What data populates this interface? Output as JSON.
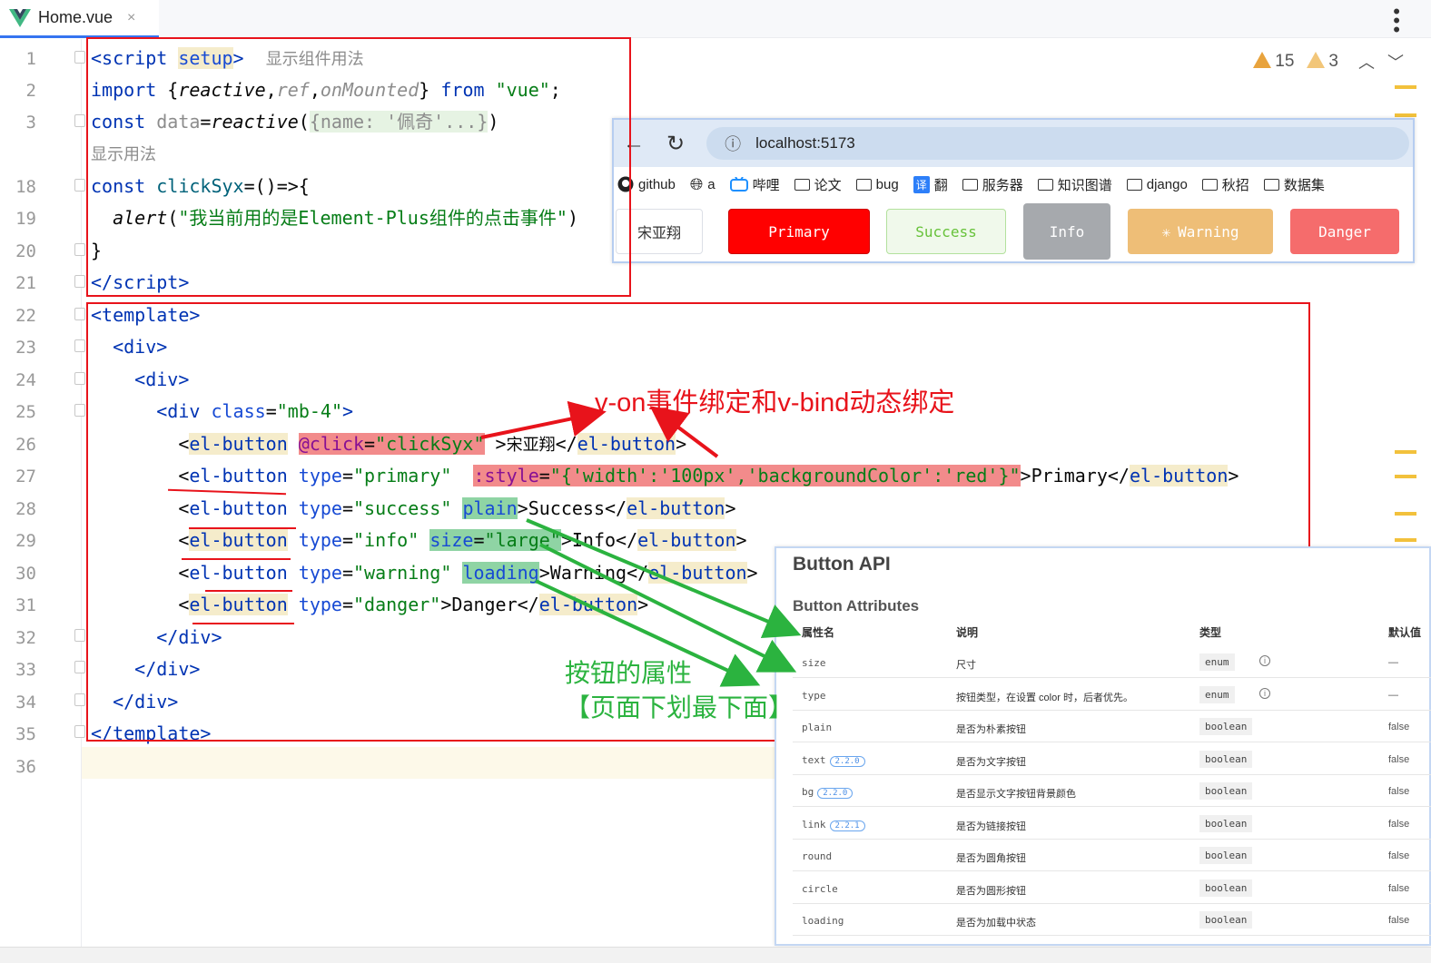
{
  "tab": {
    "filename": "Home.vue",
    "close": "×",
    "menu": "⋮"
  },
  "inspections": {
    "errors": "15",
    "warnings": "3",
    "up": "^",
    "down": "v"
  },
  "line_numbers": [
    "1",
    "2",
    "3",
    "18",
    "19",
    "20",
    "21",
    "22",
    "23",
    "24",
    "25",
    "26",
    "27",
    "28",
    "29",
    "30",
    "31",
    "32",
    "33",
    "34",
    "35",
    "36"
  ],
  "code": {
    "l1": {
      "open": "<script ",
      "setup": "setup",
      "close": ">",
      "hint": "显示组件用法"
    },
    "l2": {
      "kw": "import ",
      "brace_open": "{",
      "reactive": "reactive",
      "c1": ",",
      "ref": "ref",
      "c2": ",",
      "onMounted": "onMounted",
      "brace_close": "} ",
      "from": "from ",
      "str": "\"vue\"",
      "semi": ";"
    },
    "l3": {
      "kw": "const ",
      "var": "data",
      "eq": "=",
      "fn": "reactive",
      "p1": "(",
      "fold": "{name: '佩奇'...}",
      "p2": ")"
    },
    "l3b": "显示用法",
    "l18": {
      "kw": "const ",
      "fn": "clickSyx",
      "rest": "=()=>{"
    },
    "l19": {
      "fn": "alert",
      "p1": "(",
      "str": "\"我当前用的是Element-Plus组件的点击事件\"",
      "p2": ")"
    },
    "l20": "}",
    "l21": {
      "open": "</",
      "tag": "script",
      "close": ">"
    },
    "l22": "<template>",
    "l23": "<div>",
    "l24": "<div>",
    "l25": {
      "open": "<div ",
      "attr": "class",
      "eq": "=",
      "str": "\"mb-4\"",
      "close": ">"
    },
    "l26": {
      "lt": "<",
      "tag": "el-button",
      "sp": " ",
      "ev": "@click",
      "eq": "=",
      "str": "\"clickSyx\"",
      "gt": " >",
      "text": "宋亚翔",
      "end_lt": "</",
      "end_tag": "el-button",
      "end_gt": ">"
    },
    "l27": {
      "lt": "<",
      "tag": "el-button",
      "attr": " type",
      "eq": "=",
      "str": "\"primary\"",
      "sp": "  ",
      "bind": ":style",
      "eq2": "=",
      "str2": "\"{'width':'100px','backgroundColor':'red'}\"",
      "gt": ">",
      "text": "Primary",
      "end_lt": "</",
      "end_tag": "el-button",
      "end_gt": ">"
    },
    "l28": {
      "lt": "<",
      "tag": "el-button",
      "attr": " type",
      "eq": "=",
      "str": "\"success\"",
      "sp": " ",
      "flag": "plain",
      "gt": ">",
      "text": "Success",
      "end_lt": "</",
      "end_tag": "el-button",
      "end_gt": ">"
    },
    "l29": {
      "lt": "<",
      "tag": "el-button",
      "attr": " type",
      "eq": "=",
      "str": "\"info\"",
      "sp": " ",
      "attr2": "size",
      "eq2": "=",
      "str2": "\"large\"",
      "gt": ">",
      "text": "Info",
      "end_lt": "</",
      "end_tag": "el-button",
      "end_gt": ">"
    },
    "l30": {
      "lt": "<",
      "tag": "el-button",
      "attr": " type",
      "eq": "=",
      "str": "\"warning\"",
      "sp": " ",
      "flag": "loading",
      "gt": ">",
      "text": "Warning",
      "end_lt": "</",
      "end_tag": "el-button",
      "end_gt": ">"
    },
    "l31": {
      "lt": "<",
      "tag": "el-button",
      "attr": " type",
      "eq": "=",
      "str": "\"danger\"",
      "gt": ">",
      "text": "Danger",
      "end_lt": "</",
      "end_tag": "el-button",
      "end_gt": ">"
    },
    "l32": "</div>",
    "l33": "</div>",
    "l34": "</div>",
    "l35": "</template>"
  },
  "browser": {
    "back": "←",
    "reload": "↻",
    "info": "ⓘ",
    "url": "localhost:5173",
    "bookmarks": [
      "github",
      "a",
      "哔哩",
      "论文",
      "bug",
      "翻",
      "服务器",
      "知识图谱",
      "django",
      "秋招",
      "数据集"
    ],
    "translate_badge": "译",
    "buttons": {
      "b1": "宋亚翔",
      "primary": "Primary",
      "success": "Success",
      "info": "Info",
      "warning": "Warning",
      "danger": "Danger"
    }
  },
  "annotations": {
    "red": "v-on事件绑定和v-bind动态绑定",
    "green1": "按钮的属性",
    "green2": "【页面下划最下面】"
  },
  "api": {
    "title": "Button API",
    "subtitle": "Button Attributes",
    "headers": [
      "属性名",
      "说明",
      "类型",
      "默认值"
    ],
    "rows": [
      {
        "name": "size",
        "version": "",
        "desc": "尺寸",
        "type": "enum",
        "info": "i",
        "default": "—"
      },
      {
        "name": "type",
        "version": "",
        "desc": "按钮类型，在设置 color 时，后者优先。",
        "type": "enum",
        "info": "i",
        "default": "—"
      },
      {
        "name": "plain",
        "version": "",
        "desc": "是否为朴素按钮",
        "type": "boolean",
        "info": "",
        "default": "false"
      },
      {
        "name": "text",
        "version": "2.2.0",
        "desc": "是否为文字按钮",
        "type": "boolean",
        "info": "",
        "default": "false"
      },
      {
        "name": "bg",
        "version": "2.2.0",
        "desc": "是否显示文字按钮背景颜色",
        "type": "boolean",
        "info": "",
        "default": "false"
      },
      {
        "name": "link",
        "version": "2.2.1",
        "desc": "是否为链接按钮",
        "type": "boolean",
        "info": "",
        "default": "false"
      },
      {
        "name": "round",
        "version": "",
        "desc": "是否为圆角按钮",
        "type": "boolean",
        "info": "",
        "default": "false"
      },
      {
        "name": "circle",
        "version": "",
        "desc": "是否为圆形按钮",
        "type": "boolean",
        "info": "",
        "default": "false"
      },
      {
        "name": "loading",
        "version": "",
        "desc": "是否为加载中状态",
        "type": "boolean",
        "info": "",
        "default": "false"
      }
    ]
  },
  "colors": {
    "primary_btn": "#ff0000",
    "success_btn_bg": "#f0f9eb",
    "info_btn": "#a6a9ad",
    "warning_btn": "#eebe77",
    "danger_btn": "#f56c6c",
    "annotation_red": "#e8131b",
    "annotation_green": "#2bb33f"
  }
}
